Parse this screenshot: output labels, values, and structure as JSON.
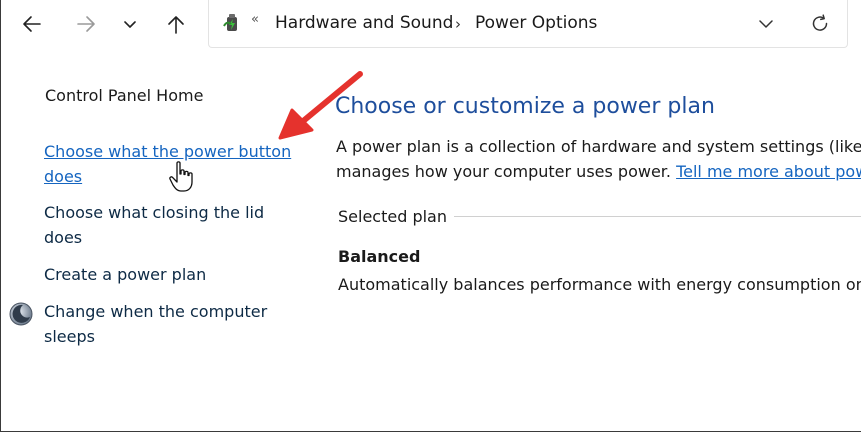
{
  "address_bar": {
    "start_separator": "«",
    "crumbs": [
      "Hardware and Sound",
      "Power Options"
    ],
    "chevron": "›"
  },
  "left_panel": {
    "home": "Control Panel Home",
    "links": [
      {
        "line1": "Choose what the power button",
        "line2": "does"
      },
      {
        "line1": "Choose what closing the lid",
        "line2": "does"
      },
      {
        "line1": "Create a power plan"
      },
      {
        "line1": "Change when the computer",
        "line2": "sleeps"
      }
    ]
  },
  "main": {
    "title": "Choose or customize a power plan",
    "description_line1": "A power plan is a collection of hardware and system settings (like d",
    "description_line2_text": "manages how your computer uses power. ",
    "description_link": "Tell me more about pow",
    "selected_plan_label": "Selected plan",
    "plan_name": "Balanced",
    "plan_description": "Automatically balances performance with energy consumption on"
  },
  "icons": {
    "back": "back-arrow-icon",
    "forward": "forward-arrow-icon",
    "recent": "chevron-down-icon",
    "up": "up-arrow-icon",
    "location": "power-options-icon",
    "refresh": "refresh-icon",
    "sleep": "moon-icon",
    "cursor": "hand-cursor-icon",
    "annotation": "red-arrow-icon"
  },
  "colors": {
    "link": "#1565c0",
    "title": "#1e4e9c",
    "annotation": "#e5322d"
  }
}
